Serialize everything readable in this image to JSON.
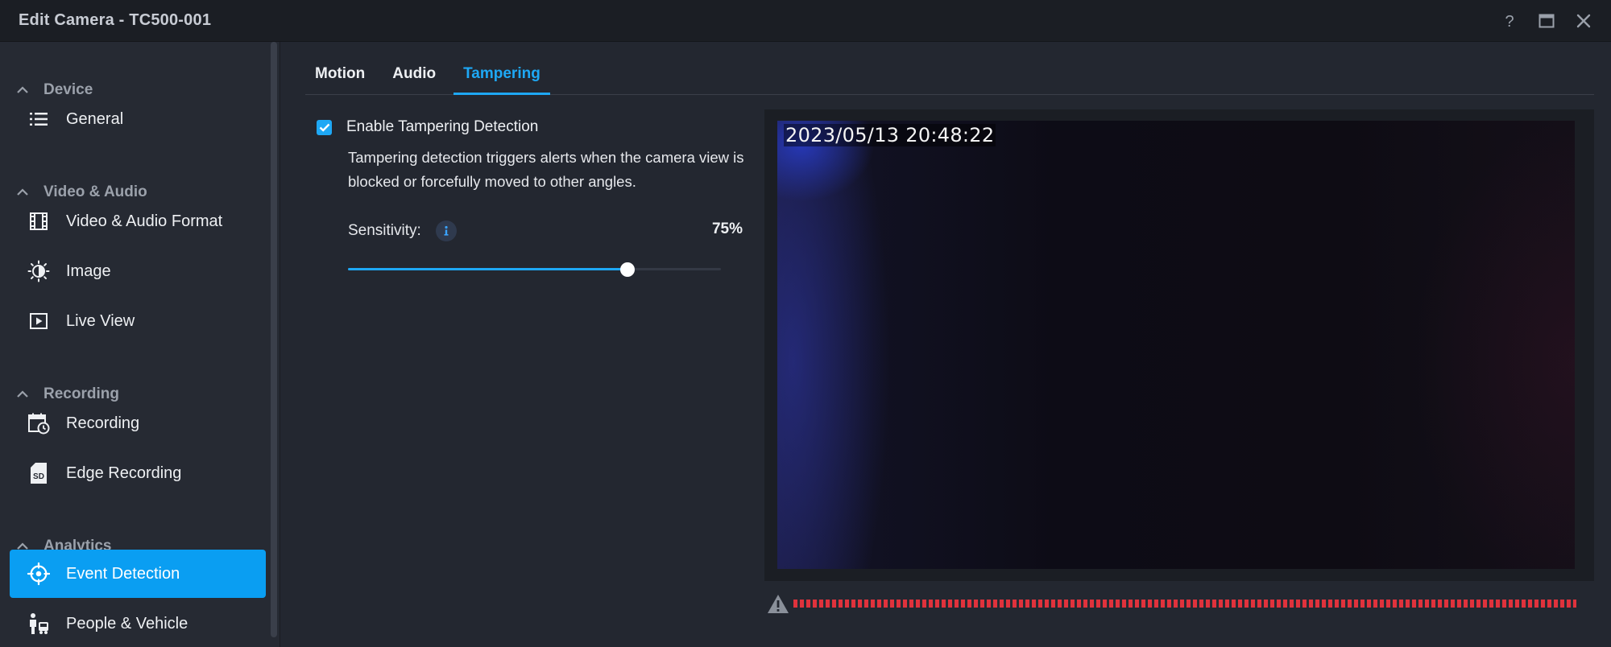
{
  "window": {
    "title": "Edit Camera - TC500-001",
    "help_icon": "help-icon",
    "maximize_icon": "maximize-icon",
    "close_icon": "close-icon"
  },
  "sidebar": {
    "sections": [
      {
        "label": "Device",
        "items": [
          {
            "label": "General",
            "icon": "list-icon"
          }
        ]
      },
      {
        "label": "Video & Audio",
        "items": [
          {
            "label": "Video & Audio Format",
            "icon": "film-icon"
          },
          {
            "label": "Image",
            "icon": "brightness-icon"
          },
          {
            "label": "Live View",
            "icon": "play-icon"
          }
        ]
      },
      {
        "label": "Recording",
        "items": [
          {
            "label": "Recording",
            "icon": "calendar-clock-icon"
          },
          {
            "label": "Edge Recording",
            "icon": "sd-card-icon"
          }
        ]
      },
      {
        "label": "Analytics",
        "items": [
          {
            "label": "Event Detection",
            "icon": "crosshair-icon",
            "active": true
          },
          {
            "label": "People & Vehicle",
            "icon": "people-vehicle-icon"
          }
        ]
      }
    ]
  },
  "tabs": [
    {
      "label": "Motion"
    },
    {
      "label": "Audio"
    },
    {
      "label": "Tampering",
      "active": true
    }
  ],
  "tampering": {
    "enable_label": "Enable Tampering Detection",
    "enabled": true,
    "description": "Tampering detection triggers alerts when the camera view is blocked or forcefully moved to other angles.",
    "sensitivity_label": "Sensitivity:",
    "sensitivity_value": "75%",
    "sensitivity_percent": 75
  },
  "preview": {
    "timestamp": "2023/05/13 20:48:22"
  },
  "colors": {
    "accent": "#1ea8f5",
    "active_nav": "#0a9ef2",
    "alert": "#e0323c"
  }
}
